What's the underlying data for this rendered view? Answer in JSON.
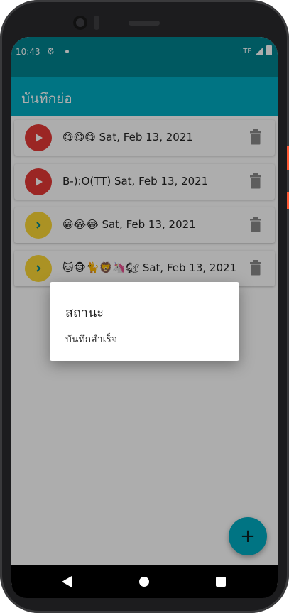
{
  "status_bar": {
    "time": "10:43",
    "network": "LTE"
  },
  "app_bar": {
    "title": "บันทึกย่อ"
  },
  "notes": [
    {
      "text": "😋😋😋 Sat, Feb 13, 2021",
      "play_color": "#e53935",
      "play_icon": "play-icon"
    },
    {
      "text": "B-):O(TT) Sat, Feb 13, 2021",
      "play_color": "#e53935",
      "play_icon": "play-icon"
    },
    {
      "text": "😁😂😂 Sat, Feb 13, 2021",
      "play_color": "#fdd835",
      "play_icon": "chevron-right-icon"
    },
    {
      "text": "🐱🐵🐈🦁🦄🐿 Sat, Feb 13, 2021",
      "play_color": "#fdd835",
      "play_icon": "chevron-right-icon"
    }
  ],
  "dialog": {
    "title": "สถานะ",
    "message": "บันทึกสำเร็จ"
  },
  "fab": {
    "label": "+"
  },
  "colors": {
    "status_bar": "#00838f",
    "app_bar": "#00acc1",
    "accent": "#00acc1"
  }
}
